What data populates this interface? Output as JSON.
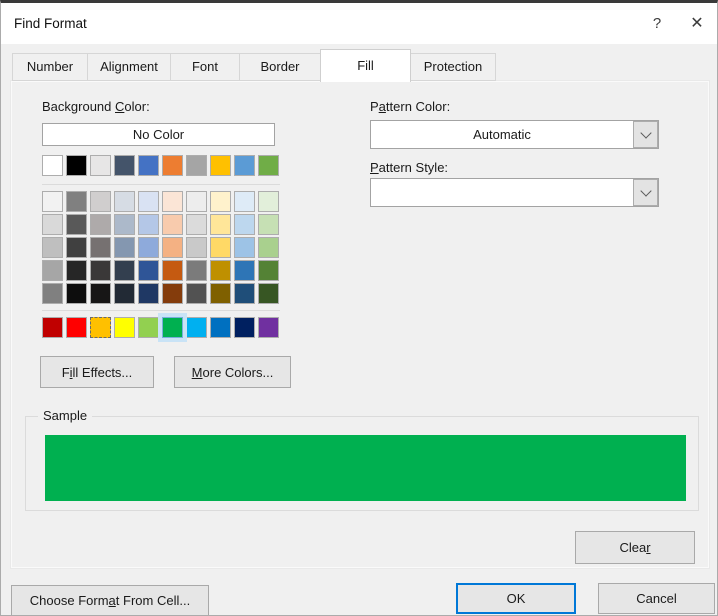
{
  "window": {
    "title": "Find Format",
    "help_icon": "?",
    "close_icon": "✕"
  },
  "tabs": [
    {
      "label": "Number",
      "selected": false
    },
    {
      "label": "Alignment",
      "selected": false
    },
    {
      "label": "Font",
      "selected": false
    },
    {
      "label": "Border",
      "selected": false
    },
    {
      "label": "Fill",
      "selected": true
    },
    {
      "label": "Protection",
      "selected": false
    }
  ],
  "fill_tab": {
    "background_color_label": {
      "pre": "Background ",
      "underline": "C",
      "post": "olor:"
    },
    "no_color_button": "No Color",
    "palette": {
      "theme_colors": [
        "#FFFFFF",
        "#000000",
        "#E7E6E6",
        "#44546A",
        "#4472C4",
        "#ED7D31",
        "#A5A5A5",
        "#FFC000",
        "#5B9BD5",
        "#70AD47"
      ],
      "tint_rows": [
        [
          "#F2F2F2",
          "#808080",
          "#D0CECE",
          "#D6DCE4",
          "#D9E2F3",
          "#FBE5D6",
          "#EDEDED",
          "#FFF2CC",
          "#DEEBF7",
          "#E2EFDA"
        ],
        [
          "#D9D9D9",
          "#595959",
          "#AEAAAA",
          "#ACB9CA",
          "#B4C7E7",
          "#F8CBAD",
          "#DBDBDB",
          "#FFE699",
          "#BDD7EE",
          "#C6E0B4"
        ],
        [
          "#BFBFBF",
          "#404040",
          "#767171",
          "#8497B0",
          "#8EAADB",
          "#F4B183",
          "#C9C9C9",
          "#FFD966",
          "#9DC3E6",
          "#A9D08E"
        ],
        [
          "#A6A6A6",
          "#262626",
          "#3A3838",
          "#333F4F",
          "#2F5597",
          "#C55A11",
          "#7B7B7B",
          "#BF9000",
          "#2E75B6",
          "#548235"
        ],
        [
          "#808080",
          "#0D0D0D",
          "#171616",
          "#222A35",
          "#1F3864",
          "#843C0C",
          "#525252",
          "#7F6000",
          "#1F4E79",
          "#375623"
        ]
      ],
      "standard_colors": [
        "#C00000",
        "#FF0000",
        "#FFC000",
        "#FFFF00",
        "#92D050",
        "#00B050",
        "#00B0F0",
        "#0070C0",
        "#002060",
        "#7030A0"
      ],
      "selected_standard_index": 5,
      "focused_standard_index": 2,
      "selected_color": "#00B050"
    },
    "fill_effects_button": {
      "pre": "F",
      "underline": "i",
      "post": "ll Effects..."
    },
    "more_colors_button": {
      "pre": "",
      "underline": "M",
      "post": "ore Colors..."
    },
    "pattern_color_label": {
      "pre": "P",
      "underline": "a",
      "post": "ttern Color:"
    },
    "pattern_color_value": "Automatic",
    "pattern_style_label": {
      "pre": "",
      "underline": "P",
      "post": "attern Style:"
    },
    "pattern_style_value": "",
    "sample": {
      "legend": "Sample",
      "fill_color": "#00B050"
    },
    "clear_button": {
      "pre": "Clea",
      "underline": "r",
      "post": ""
    }
  },
  "footer": {
    "choose_format_button": {
      "pre": "Choose Form",
      "underline": "a",
      "post": "t From Cell..."
    },
    "ok_button": "OK",
    "cancel_button": "Cancel"
  },
  "colors": {
    "dialog_bg": "#F0F0F0",
    "titlebar_bg": "#FFFFFF",
    "accent_blue": "#0078D7"
  }
}
